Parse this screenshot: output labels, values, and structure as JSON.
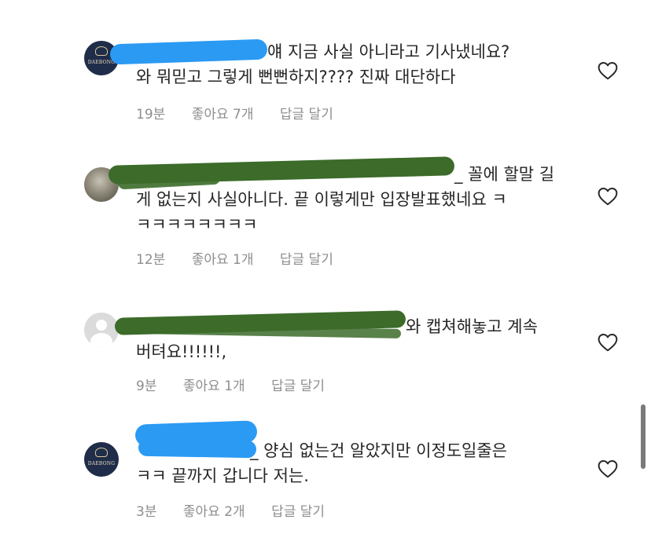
{
  "comments": [
    {
      "avatar": "brand-logo-avatar",
      "avatar_text": "DAEBONG",
      "line1": "얘 지금 사실 아니라고 기사냈네요?",
      "line2": "와 뭐믿고 그렇게 뻔뻔하지???? 진짜 대단하다",
      "time": "19분",
      "likes": "좋아요 7개",
      "reply": "답글 달기"
    },
    {
      "avatar": "photo-avatar",
      "line1": "_ 꼴에 할말 길",
      "line2": "게 없는지 사실아니다. 끝 이렇게만 입장발표했네요 ㅋ",
      "line3": "ㅋㅋㅋㅋㅋㅋㅋㅋ",
      "time": "12분",
      "likes": "좋아요 1개",
      "reply": "답글 달기"
    },
    {
      "avatar": "default-avatar",
      "line1": "와 캡쳐해놓고 계속",
      "line2": "버텨요!!!!!!,",
      "time": "9분",
      "likes": "좋아요 1개",
      "reply": "답글 달기"
    },
    {
      "avatar": "brand-logo-avatar",
      "avatar_text": "DAEBONG",
      "line1": "_ 양심 없는건 알았지만 이정도일줄은",
      "line2": "ㅋㅋ 끝까지 갑니다 저는.",
      "time": "3분",
      "likes": "좋아요 2개",
      "reply": "답글 달기"
    }
  ],
  "colors": {
    "text": "#262626",
    "meta": "#8e8e8e",
    "blue_scribble": "#2b9af3",
    "green_scribble": "#3c6b2a"
  },
  "icons": {
    "like": "heart-outline-icon"
  }
}
